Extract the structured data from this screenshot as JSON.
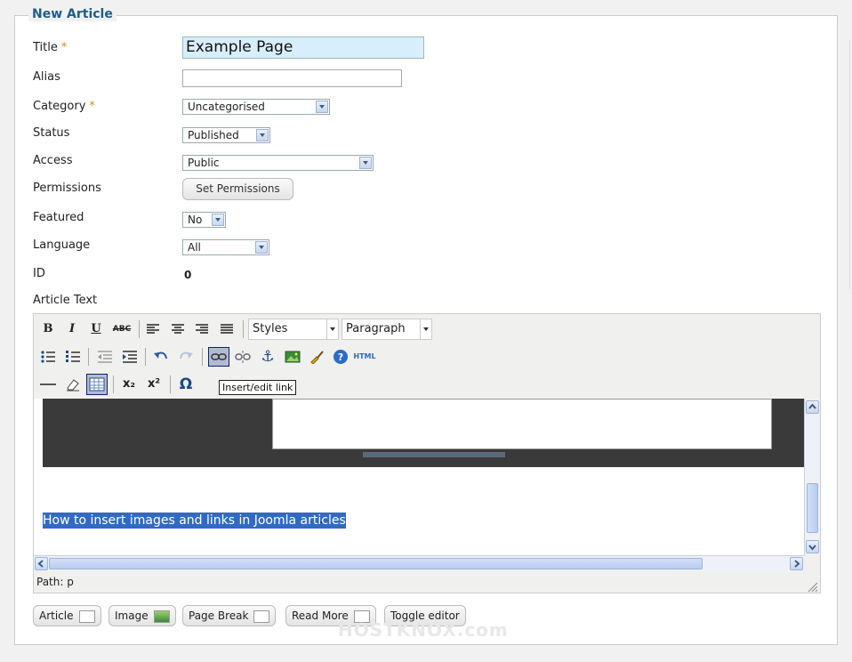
{
  "form": {
    "legend": "New Article",
    "title_label": "Title",
    "title_value": "Example Page",
    "alias_label": "Alias",
    "alias_value": "",
    "category_label": "Category",
    "category_value": "Uncategorised",
    "status_label": "Status",
    "status_value": "Published",
    "access_label": "Access",
    "access_value": "Public",
    "permissions_label": "Permissions",
    "permissions_button": "Set Permissions",
    "featured_label": "Featured",
    "featured_value": "No",
    "language_label": "Language",
    "language_value": "All",
    "id_label": "ID",
    "id_value": "0",
    "article_text_label": "Article Text",
    "required_mark": "*"
  },
  "editor": {
    "styles_select": "Styles",
    "format_select": "Paragraph",
    "tooltip": "Insert/edit link",
    "selected_text": "How to insert images and links in Joomla articles",
    "trailing_text": ".",
    "path": "Path: p",
    "buttons": {
      "bold": "B",
      "italic": "I",
      "underline": "U",
      "strike": "ABC",
      "html": "HTML",
      "omega": "Ω",
      "subscript": "x₂",
      "superscript": "x²"
    }
  },
  "bottom_buttons": {
    "article": "Article",
    "image": "Image",
    "page_break": "Page Break",
    "read_more": "Read More",
    "toggle_editor": "Toggle editor"
  },
  "watermark": "HOSTKNOX.com"
}
